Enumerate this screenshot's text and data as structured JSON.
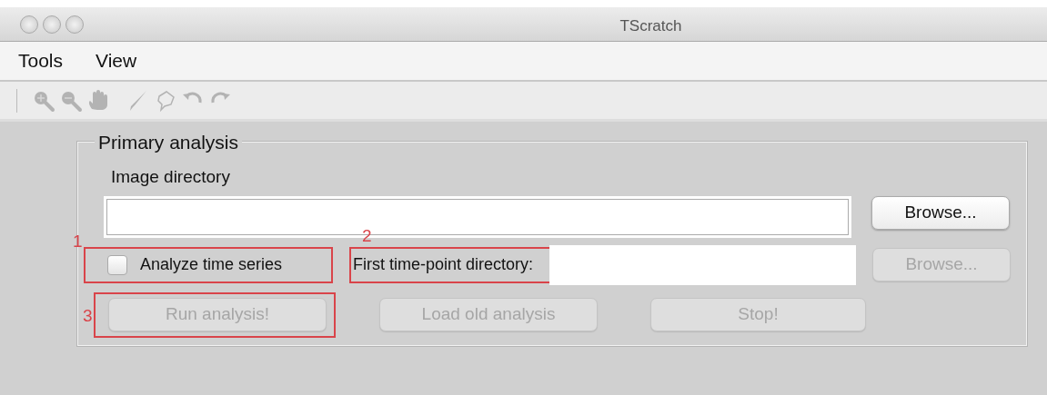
{
  "window": {
    "title": "TScratch"
  },
  "menu": [
    {
      "label": "Tools"
    },
    {
      "label": "View"
    }
  ],
  "panel": {
    "title": "Primary analysis",
    "image_directory": {
      "label": "Image directory",
      "browse": {
        "label": "Browse...",
        "disabled": false
      }
    },
    "time_series": {
      "label": "Analyze time series",
      "checked": false,
      "annotation": "1"
    },
    "first_timepoint": {
      "label": "First time-point directory:",
      "annotation": "2",
      "browse": {
        "label": "Browse...",
        "disabled": true
      }
    },
    "actions": [
      {
        "label": "Run analysis!",
        "disabled": true,
        "annotation": "3"
      },
      {
        "label": "Load old analysis",
        "disabled": true
      },
      {
        "label": "Stop!",
        "disabled": true
      }
    ]
  }
}
